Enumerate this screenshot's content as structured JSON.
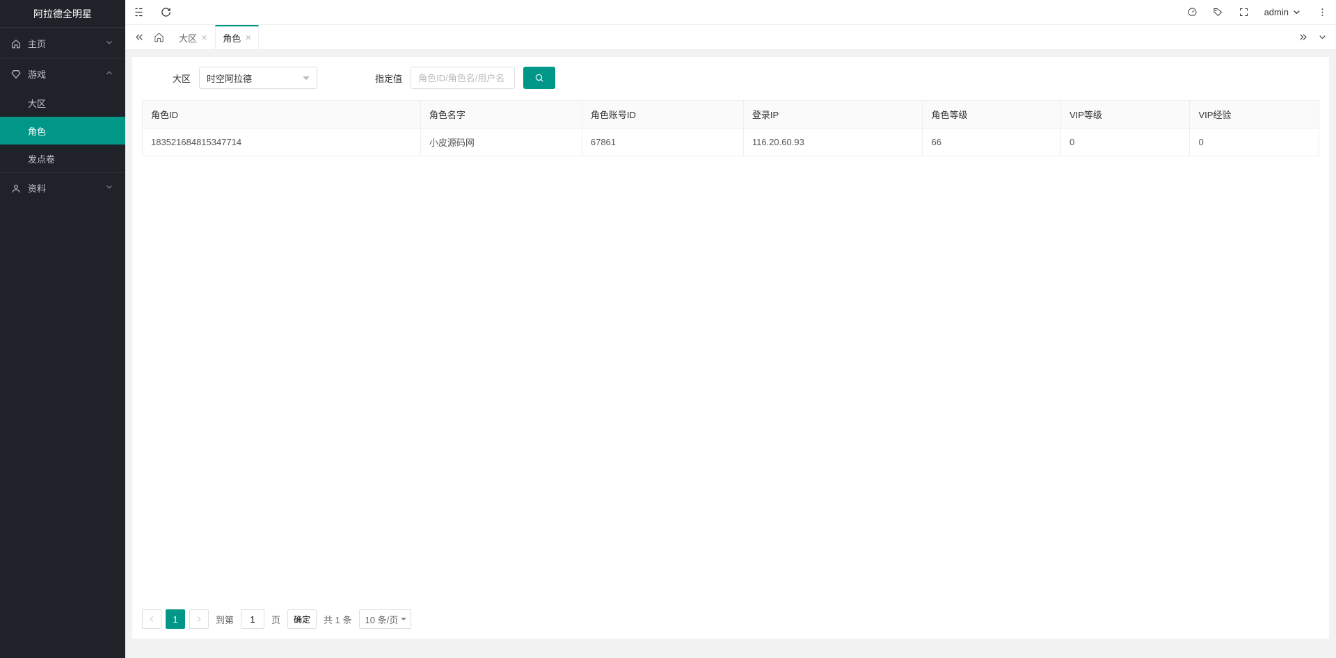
{
  "app_title": "阿拉德全明星",
  "user": {
    "name": "admin"
  },
  "sidebar": {
    "items": [
      {
        "label": "主页",
        "icon": "home"
      },
      {
        "label": "游戏",
        "icon": "diamond"
      },
      {
        "label": "资料",
        "icon": "user"
      }
    ],
    "game_sub": [
      {
        "label": "大区"
      },
      {
        "label": "角色"
      },
      {
        "label": "发点卷"
      }
    ]
  },
  "tabs": {
    "list": [
      {
        "label": "大区",
        "closable": true
      },
      {
        "label": "角色",
        "closable": true,
        "active": true
      }
    ]
  },
  "filter": {
    "region_label": "大区",
    "region_value": "时空阿拉德",
    "keyword_label": "指定值",
    "keyword_placeholder": "角色ID/角色名/用户名"
  },
  "table": {
    "columns": [
      "角色ID",
      "角色名字",
      "角色账号ID",
      "登录IP",
      "角色等级",
      "VIP等级",
      "VIP经验"
    ],
    "rows": [
      {
        "c0": "183521684815347714",
        "c1": "小皮源码网",
        "c2": "67861",
        "c3": "116.20.60.93",
        "c4": "66",
        "c5": "0",
        "c6": "0"
      }
    ]
  },
  "pagination": {
    "current": "1",
    "goto_label": "到第",
    "goto_value": "1",
    "page_label": "页",
    "confirm": "确定",
    "total": "共 1 条",
    "per_page": "10 条/页"
  }
}
